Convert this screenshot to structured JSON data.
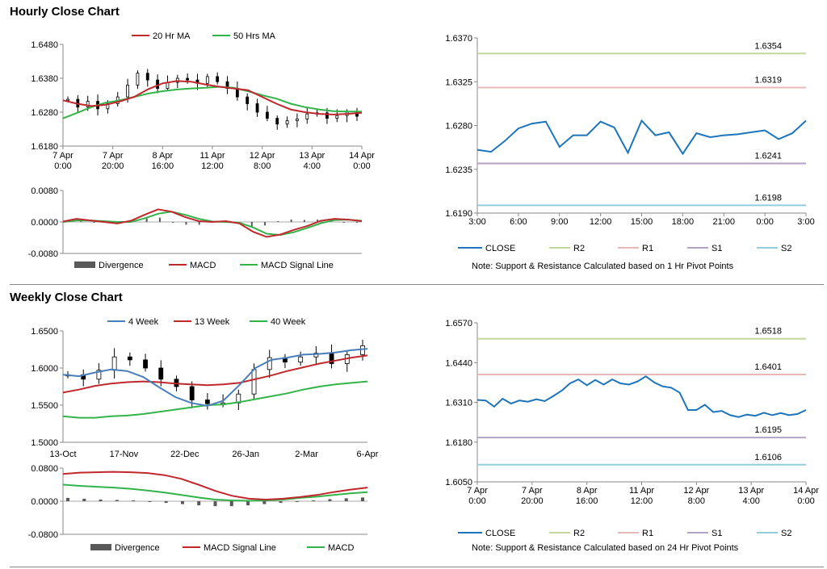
{
  "sections": {
    "hourly_title": "Hourly Close Chart",
    "weekly_title": "Weekly Close Chart"
  },
  "colors": {
    "ma_red": "#c0282d",
    "ma_green": "#33b44a",
    "close_blue": "#1c75bc",
    "week4_blue": "#4a7ebb",
    "r2": "#c3d69b",
    "r1": "#e6b9b8",
    "s1": "#b3a2c7",
    "s2": "#93cddd",
    "candle": "#000000",
    "divergence": "#595959"
  },
  "chart_data": [
    {
      "id": "hourly_price",
      "type": "line",
      "x_ticks": [
        "7 Apr\n0:00",
        "7 Apr\n20:00",
        "8 Apr\n16:00",
        "11 Apr\n12:00",
        "12 Apr\n8:00",
        "13 Apr\n4:00",
        "14 Apr\n0:00"
      ],
      "ylim": [
        1.618,
        1.648
      ],
      "y_ticks": [
        "1.6480",
        "1.6380",
        "1.6280",
        "1.6180"
      ],
      "legend": [
        "20 Hr MA",
        "50 Hrs MA"
      ],
      "series": [
        {
          "name": "20 Hr MA",
          "values": [
            1.6315,
            1.6305,
            1.6298,
            1.6302,
            1.6312,
            1.6325,
            1.6348,
            1.6365,
            1.6372,
            1.637,
            1.6362,
            1.6355,
            1.635,
            1.6345,
            1.6325,
            1.6305,
            1.6288,
            1.628,
            1.6275,
            1.6273,
            1.6275,
            1.6278
          ]
        },
        {
          "name": "50 Hrs MA",
          "values": [
            1.6262,
            1.6278,
            1.6295,
            1.6308,
            1.6315,
            1.6325,
            1.6335,
            1.6342,
            1.6347,
            1.635,
            1.6352,
            1.6355,
            1.6352,
            1.6342,
            1.633,
            1.632,
            1.6305,
            1.6295,
            1.6288,
            1.6283,
            1.6282,
            1.6282
          ]
        }
      ],
      "candles": [
        1.6318,
        1.6295,
        1.6312,
        1.629,
        1.6305,
        1.6325,
        1.636,
        1.6395,
        1.6375,
        1.635,
        1.6368,
        1.638,
        1.6375,
        1.6365,
        1.6385,
        1.637,
        1.635,
        1.6325,
        1.6305,
        1.628,
        1.6262,
        1.6245,
        1.6255,
        1.626,
        1.6275,
        1.6278,
        1.6262,
        1.627,
        1.628,
        1.6268
      ]
    },
    {
      "id": "hourly_macd",
      "type": "line",
      "ylim": [
        -0.008,
        0.008
      ],
      "y_ticks": [
        "0.0080",
        "0.0000",
        "-0.0080"
      ],
      "legend": [
        "Divergence",
        "MACD",
        "MACD Signal Line"
      ],
      "series": [
        {
          "name": "MACD",
          "values": [
            0.0001,
            0.0008,
            0.0004,
            0.0,
            -0.0004,
            0.0003,
            0.0018,
            0.0032,
            0.0026,
            0.0012,
            0.0002,
            0.0,
            0.0002,
            -0.0004,
            -0.0025,
            -0.0038,
            -0.0032,
            -0.002,
            -0.001,
            0.0003,
            0.0008,
            0.0006,
            0.0002
          ]
        },
        {
          "name": "MACD Signal Line",
          "values": [
            0.0,
            0.0004,
            0.0004,
            0.0002,
            0.0,
            0.0,
            0.0009,
            0.0021,
            0.0026,
            0.0018,
            0.0008,
            0.0001,
            0.0,
            -0.0002,
            -0.0014,
            -0.003,
            -0.0033,
            -0.0026,
            -0.0015,
            -0.0003,
            0.0005,
            0.0006,
            0.0003
          ]
        }
      ],
      "divergence": [
        0.0002,
        0.0003,
        0.0,
        -0.0002,
        -0.0004,
        0.0003,
        0.0009,
        0.0011,
        0.0,
        -0.0007,
        -0.0007,
        -0.0002,
        0.0002,
        -0.0002,
        -0.0011,
        -0.0009,
        0.0002,
        0.0006,
        0.0005,
        0.0006,
        0.0003,
        0.0,
        -0.0001
      ]
    },
    {
      "id": "hourly_close_pivot",
      "type": "line",
      "x_ticks": [
        "3:00",
        "6:00",
        "9:00",
        "12:00",
        "15:00",
        "18:00",
        "21:00",
        "0:00",
        "3:00"
      ],
      "ylim": [
        1.619,
        1.637
      ],
      "y_ticks": [
        "1.6370",
        "1.6325",
        "1.6280",
        "1.6235",
        "1.6190"
      ],
      "legend": [
        "CLOSE",
        "R2",
        "R1",
        "S1",
        "S2"
      ],
      "levels": {
        "R2": "1.6354",
        "R1": "1.6319",
        "S1": "1.6241",
        "S2": "1.6198"
      },
      "series": [
        {
          "name": "CLOSE",
          "values": [
            1.6255,
            1.6253,
            1.6264,
            1.6277,
            1.6282,
            1.6284,
            1.6258,
            1.627,
            1.627,
            1.6284,
            1.6278,
            1.6252,
            1.6285,
            1.627,
            1.6273,
            1.6251,
            1.6272,
            1.6268,
            1.627,
            1.6271,
            1.6273,
            1.6275,
            1.6266,
            1.6272,
            1.6285
          ]
        }
      ],
      "note": "Note: Support & Resistance Calculated based on 1 Hr Pivot Points"
    },
    {
      "id": "weekly_price",
      "type": "line",
      "x_ticks": [
        "13-Oct",
        "17-Nov",
        "22-Dec",
        "26-Jan",
        "2-Mar",
        "6-Apr"
      ],
      "ylim": [
        1.5,
        1.65
      ],
      "y_ticks": [
        "1.6500",
        "1.6000",
        "1.5500",
        "1.5000"
      ],
      "legend": [
        "4 Week",
        "13 Week",
        "40 Week"
      ],
      "series": [
        {
          "name": "4 Week",
          "values": [
            1.591,
            1.589,
            1.594,
            1.598,
            1.596,
            1.588,
            1.574,
            1.561,
            1.553,
            1.549,
            1.556,
            1.577,
            1.6,
            1.611,
            1.614,
            1.618,
            1.619,
            1.621,
            1.624,
            1.626
          ]
        },
        {
          "name": "13 Week",
          "values": [
            1.567,
            1.571,
            1.576,
            1.579,
            1.581,
            1.582,
            1.581,
            1.579,
            1.578,
            1.577,
            1.578,
            1.58,
            1.585,
            1.59,
            1.596,
            1.601,
            1.606,
            1.61,
            1.614,
            1.617
          ]
        },
        {
          "name": "40 Week",
          "values": [
            1.535,
            1.533,
            1.533,
            1.535,
            1.536,
            1.538,
            1.541,
            1.544,
            1.547,
            1.55,
            1.551,
            1.554,
            1.558,
            1.562,
            1.566,
            1.571,
            1.575,
            1.578,
            1.58,
            1.582
          ]
        }
      ],
      "candles": [
        1.591,
        1.585,
        1.597,
        1.615,
        1.611,
        1.6,
        1.585,
        1.575,
        1.557,
        1.552,
        1.553,
        1.565,
        1.598,
        1.614,
        1.608,
        1.615,
        1.62,
        1.606,
        1.618,
        1.63
      ]
    },
    {
      "id": "weekly_macd",
      "type": "line",
      "ylim": [
        -0.08,
        0.08
      ],
      "y_ticks": [
        "0.0800",
        "0.0000",
        "-0.0800"
      ],
      "legend": [
        "Divergence",
        "MACD Signal Line",
        "MACD"
      ],
      "series": [
        {
          "name": "MACD Signal Line",
          "values": [
            0.066,
            0.069,
            0.07,
            0.071,
            0.07,
            0.068,
            0.063,
            0.054,
            0.04,
            0.025,
            0.013,
            0.006,
            0.004,
            0.006,
            0.01,
            0.015,
            0.022,
            0.028,
            0.033
          ]
        },
        {
          "name": "MACD",
          "values": [
            0.04,
            0.037,
            0.035,
            0.033,
            0.03,
            0.026,
            0.021,
            0.015,
            0.009,
            0.004,
            0.002,
            0.001,
            0.002,
            0.004,
            0.008,
            0.011,
            0.015,
            0.019,
            0.022
          ]
        }
      ],
      "divergence": [
        0.008,
        0.006,
        0.004,
        0.003,
        0.002,
        0.0,
        -0.004,
        -0.007,
        -0.01,
        -0.012,
        -0.012,
        -0.01,
        -0.007,
        -0.004,
        -0.001,
        0.002,
        0.005,
        0.007,
        0.009
      ]
    },
    {
      "id": "daily_close_pivot",
      "type": "line",
      "x_ticks": [
        "7 Apr\n0:00",
        "7 Apr\n20:00",
        "8 Apr\n16:00",
        "11 Apr\n12:00",
        "12 Apr\n8:00",
        "13 Apr\n4:00",
        "14 Apr\n0:00"
      ],
      "ylim": [
        1.605,
        1.657
      ],
      "y_ticks": [
        "1.6570",
        "1.6440",
        "1.6310",
        "1.6180",
        "1.6050"
      ],
      "legend": [
        "CLOSE",
        "R2",
        "R1",
        "S1",
        "S2"
      ],
      "levels": {
        "R2": "1.6518",
        "R1": "1.6401",
        "S1": "1.6195",
        "S2": "1.6106"
      },
      "series": [
        {
          "name": "CLOSE",
          "values": [
            1.6318,
            1.6316,
            1.6296,
            1.6322,
            1.6306,
            1.6316,
            1.6312,
            1.632,
            1.6314,
            1.633,
            1.6348,
            1.6372,
            1.6385,
            1.6366,
            1.6383,
            1.6368,
            1.6385,
            1.6372,
            1.6368,
            1.6378,
            1.6395,
            1.6375,
            1.6362,
            1.6358,
            1.6342,
            1.6285,
            1.6285,
            1.6302,
            1.6278,
            1.6282,
            1.6268,
            1.6262,
            1.627,
            1.6266,
            1.6276,
            1.6268,
            1.6275,
            1.6268,
            1.6272,
            1.6285
          ]
        }
      ],
      "note": "Note: Support & Resistance Calculated based on 24 Hr Pivot Points"
    }
  ]
}
